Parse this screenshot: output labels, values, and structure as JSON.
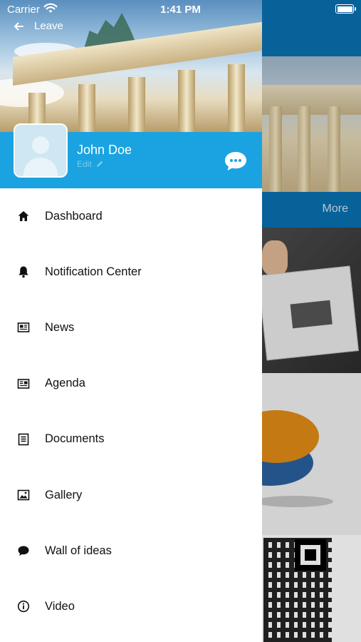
{
  "status_bar": {
    "carrier": "Carrier",
    "time": "1:41 PM"
  },
  "drawer": {
    "back_label": "Leave",
    "user": {
      "name": "John Doe",
      "edit_label": "Edit"
    },
    "menu": [
      {
        "label": "Dashboard",
        "icon": "home-icon"
      },
      {
        "label": "Notification Center",
        "icon": "bell-icon"
      },
      {
        "label": "News",
        "icon": "newspaper-icon"
      },
      {
        "label": "Agenda",
        "icon": "agenda-icon"
      },
      {
        "label": "Documents",
        "icon": "document-icon"
      },
      {
        "label": "Gallery",
        "icon": "image-icon"
      },
      {
        "label": "Wall of ideas",
        "icon": "speech-bubble-icon"
      },
      {
        "label": "Video",
        "icon": "info-icon"
      }
    ]
  },
  "background": {
    "more_label": "More"
  },
  "colors": {
    "primary": "#1AA3E0",
    "bg_bar": "#0A70B0",
    "text": "#111111"
  }
}
